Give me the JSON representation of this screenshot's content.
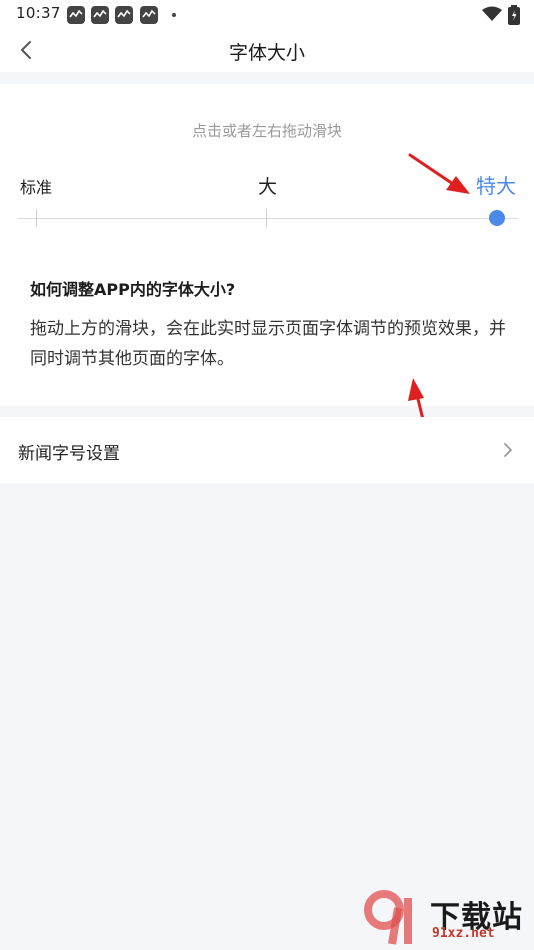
{
  "status_bar": {
    "time": "10:37"
  },
  "header": {
    "title": "字体大小"
  },
  "slider": {
    "hint": "点击或者左右拖动滑块",
    "labels": {
      "standard": "标准",
      "large": "大",
      "xlarge": "特大"
    },
    "selected": "特大",
    "level": 1.0,
    "accent_color": "#4a8ae6"
  },
  "faq": {
    "title": "如何调整APP内的字体大小?",
    "body": "拖动上方的滑块，会在此实时显示页面字体调节的预览效果，并同时调节其他页面的字体。"
  },
  "settings": {
    "news_font_size": "新闻字号设置"
  },
  "watermark": {
    "cn": "下载站",
    "domain": "91xz.net"
  },
  "icons": [
    "back-icon",
    "wifi-icon",
    "battery-icon",
    "chevron-right-icon",
    "notification-icon"
  ]
}
